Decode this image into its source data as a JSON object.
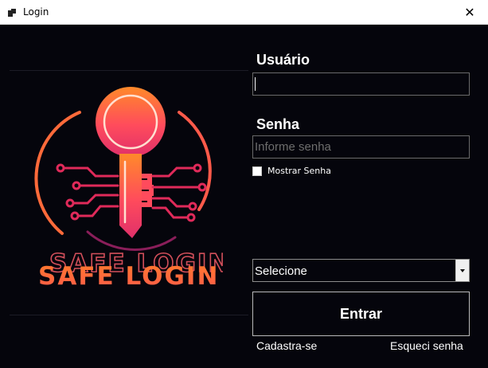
{
  "window": {
    "title": "Login",
    "close_glyph": "✕",
    "icon": "app-window-icon"
  },
  "logo": {
    "text": "SAFE LOGIN",
    "icon": "key-circuit-icon",
    "colors": {
      "gradient_top": "#ff8a2a",
      "gradient_mid": "#ff4b5c",
      "gradient_bottom": "#e0306a",
      "circuit": "#e02a5a",
      "ring": "#7a1a5a"
    }
  },
  "form": {
    "user_label": "Usuário",
    "user_value": "",
    "password_label": "Senha",
    "password_placeholder": "Informe senha",
    "show_password_label": "Mostrar Senha",
    "show_password_checked": false,
    "role_select_value": "Selecione",
    "submit_label": "Entrar",
    "register_link": "Cadastra-se",
    "forgot_link": "Esqueci senha"
  },
  "theme": {
    "background": "#05050c",
    "text": "#ffffff",
    "border": "#6a6a6a"
  }
}
